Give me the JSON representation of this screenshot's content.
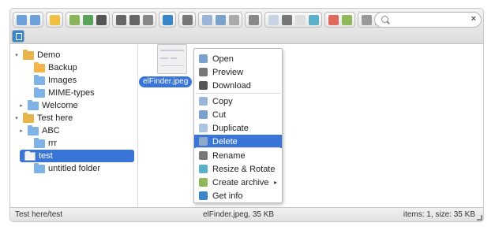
{
  "colors": {
    "selection": "#3875d7",
    "toolbar_top": "#f3f3f3",
    "toolbar_bottom": "#dcdcdc"
  },
  "toolbar": {
    "groups": [
      [
        "back-icon",
        "forward-icon"
      ],
      [
        "home-icon"
      ],
      [
        "open-icon",
        "download-icon",
        "save-icon"
      ],
      [
        "upload-icon",
        "mkdir-icon",
        "mkfile-icon"
      ],
      [
        "info-icon"
      ],
      [
        "quicklook-icon"
      ],
      [
        "copy-icon",
        "cut-icon",
        "paste-icon"
      ],
      [
        "rm-icon"
      ],
      [
        "duplicate-icon",
        "rename-icon",
        "edit-icon",
        "resize-icon"
      ],
      [
        "extract-icon",
        "archive-icon"
      ],
      [
        "view-icon",
        "sort-icon"
      ]
    ],
    "search_placeholder": ""
  },
  "tree": [
    {
      "label": "Demo",
      "icon": "home-folder-icon",
      "arrow": "▾"
    },
    {
      "label": "Backup",
      "icon": "backup-folder-icon",
      "arrow": ""
    },
    {
      "label": "Images",
      "icon": "folder-icon",
      "arrow": ""
    },
    {
      "label": "MIME-types",
      "icon": "folder-icon",
      "arrow": ""
    },
    {
      "label": "Welcome",
      "icon": "folder-icon",
      "arrow": "▸"
    },
    {
      "label": "Test here",
      "icon": "home-folder-icon",
      "arrow": "▾"
    },
    {
      "label": "ABC",
      "icon": "folder-icon",
      "arrow": "▸"
    },
    {
      "label": "rrr",
      "icon": "folder-icon",
      "arrow": ""
    },
    {
      "label": "test",
      "icon": "folder-icon",
      "arrow": ""
    },
    {
      "label": "untitled folder",
      "icon": "folder-icon",
      "arrow": ""
    }
  ],
  "file": {
    "name": "elFinder.jpeg"
  },
  "context_menu": [
    {
      "label": "Open",
      "icon": "open-icon"
    },
    {
      "label": "Preview",
      "icon": "preview-icon"
    },
    {
      "label": "Download",
      "icon": "download-icon"
    },
    {
      "label": "Copy",
      "icon": "copy-icon"
    },
    {
      "label": "Cut",
      "icon": "cut-icon"
    },
    {
      "label": "Duplicate",
      "icon": "duplicate-icon"
    },
    {
      "label": "Delete",
      "icon": "delete-icon"
    },
    {
      "label": "Rename",
      "icon": "rename-icon"
    },
    {
      "label": "Resize & Rotate",
      "icon": "resize-icon"
    },
    {
      "label": "Create archive",
      "icon": "archive-icon"
    },
    {
      "label": "Get info",
      "icon": "info-icon"
    }
  ],
  "submenu_arrow": "▸",
  "statusbar": {
    "path": "Test here/test",
    "selected": "elFinder.jpeg, 35 KB",
    "summary": "items: 1, size: 35 KB"
  }
}
